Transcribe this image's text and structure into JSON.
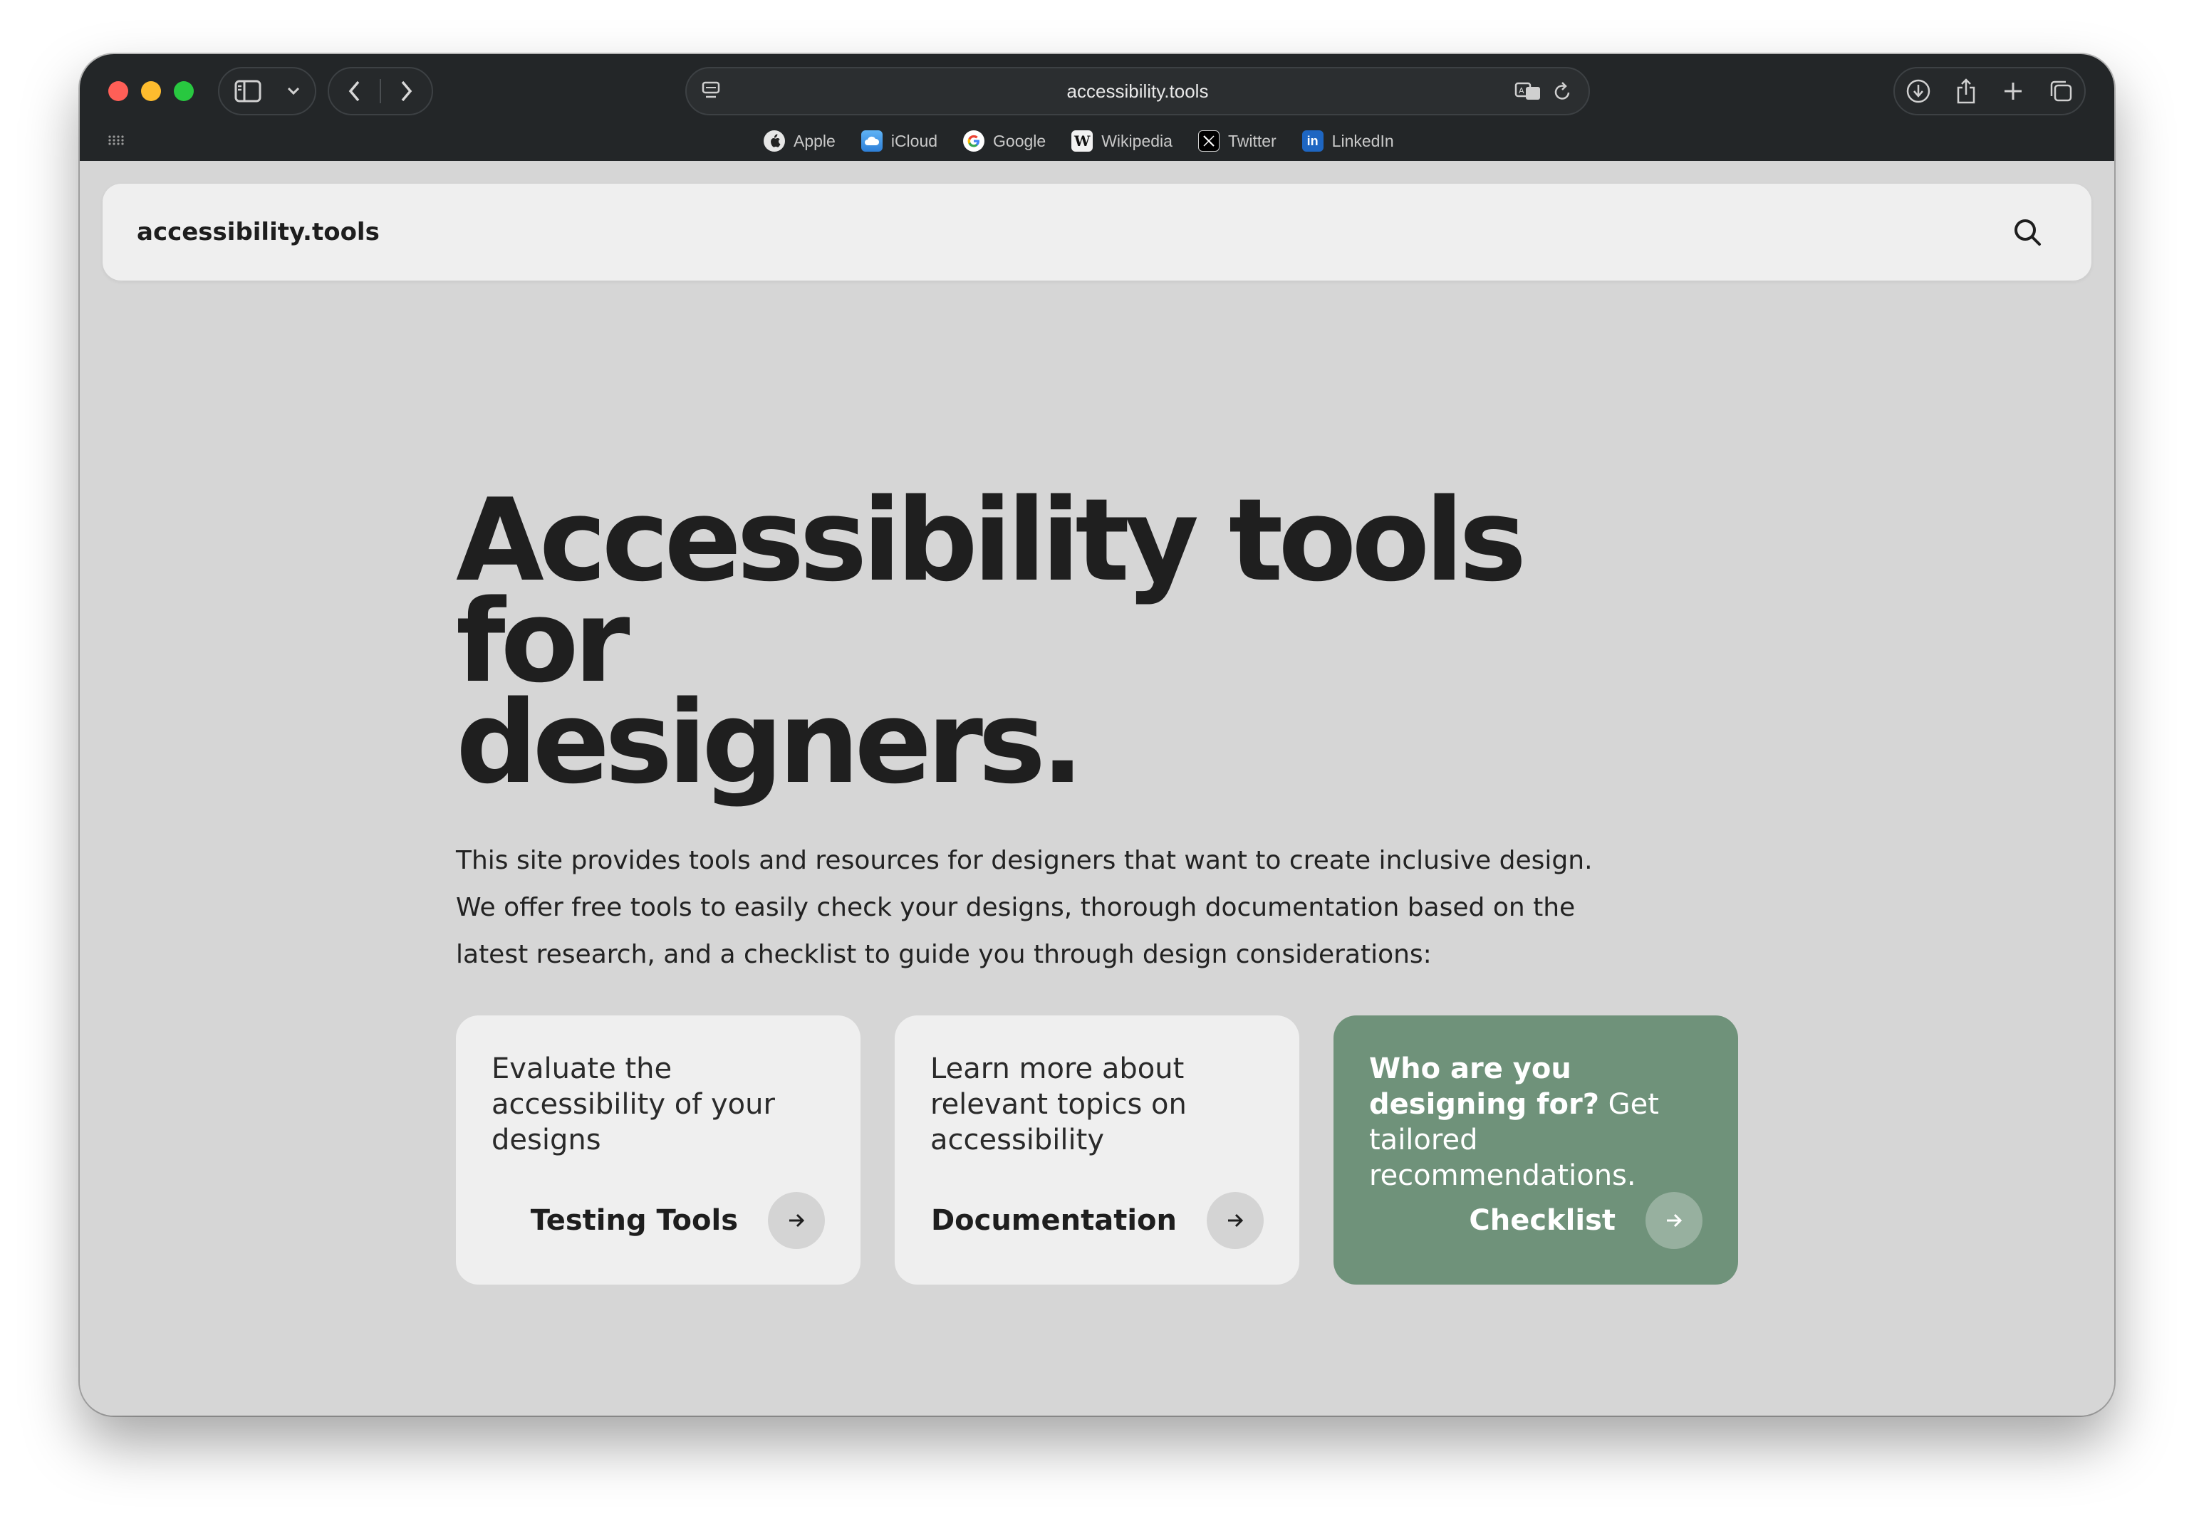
{
  "browser": {
    "url": "accessibility.tools",
    "favorites": [
      {
        "label": "Apple",
        "icon": "apple-icon"
      },
      {
        "label": "iCloud",
        "icon": "icloud-icon"
      },
      {
        "label": "Google",
        "icon": "google-icon"
      },
      {
        "label": "Wikipedia",
        "icon": "wikipedia-icon"
      },
      {
        "label": "Twitter",
        "icon": "twitter-x-icon"
      },
      {
        "label": "LinkedIn",
        "icon": "linkedin-icon"
      }
    ]
  },
  "site": {
    "logo": "accessibility.tools"
  },
  "hero": {
    "title_line1": "Accessibility tools for",
    "title_line2": "designers.",
    "intro": "This site provides tools and resources for designers that want to create inclusive design. We offer free tools to easily check your designs, thorough documentation based on the latest research, and a checklist to guide you through design considerations:"
  },
  "cards": [
    {
      "description": "Evaluate the accessibility of your designs",
      "label": "Testing Tools"
    },
    {
      "description": "Learn more about relevant topics on accessibility",
      "label": "Documentation"
    },
    {
      "description_bold": "Who are you designing for?",
      "description_rest": " Get tailored recommendations.",
      "label": "Checklist"
    }
  ],
  "colors": {
    "accent_green": "#6f927a",
    "page_background": "#d6d6d6",
    "chrome_background": "#232628"
  }
}
